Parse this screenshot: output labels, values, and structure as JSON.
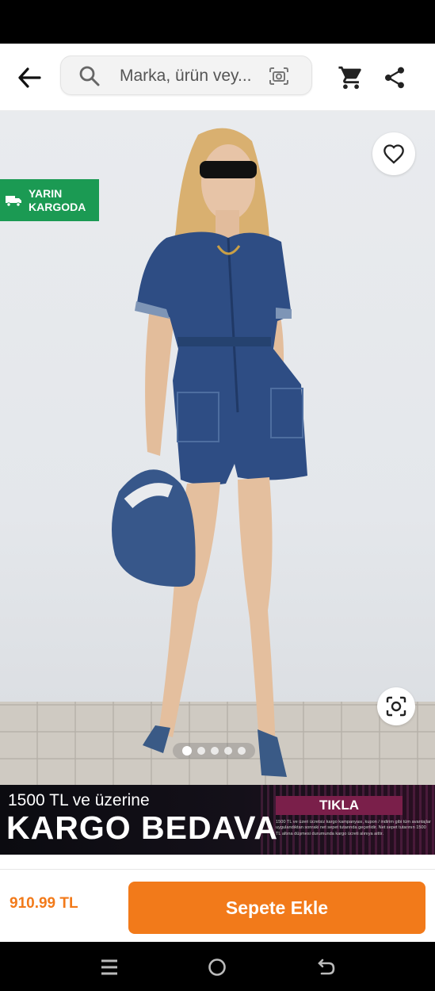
{
  "search": {
    "placeholder": "Marka, ürün vey..."
  },
  "delivery_badge": {
    "line1": "YARIN",
    "line2": "KARGODA"
  },
  "gallery": {
    "image_count": 5,
    "active_index": 0
  },
  "promo_banner": {
    "line1": "1500 TL ve üzerine",
    "line2": "KARGO BEDAVA",
    "cta_label": "TIKLA",
    "fine_print": "1500 TL ve üzeri ücretsiz kargo kampanyası, kupon / indirim gibi tüm avantajlar uygulandıktan sonraki net sepet tutarında geçerlidir. Net sepet tutarının 1500 TL altına düşmesi durumunda kargo ücreti alınıya aittir."
  },
  "product": {
    "price": "910.99 TL",
    "add_to_cart_label": "Sepete Ekle"
  },
  "colors": {
    "brand_orange": "#f27a1a",
    "delivery_green": "#1b9a53",
    "banner_accent": "#7a1f4a"
  },
  "icons": [
    "arrow-left-icon",
    "search-icon",
    "camera-search-icon",
    "cart-icon",
    "share-icon",
    "truck-icon",
    "heart-icon",
    "lens-icon",
    "menu-icon",
    "home-circle-icon",
    "back-icon"
  ]
}
